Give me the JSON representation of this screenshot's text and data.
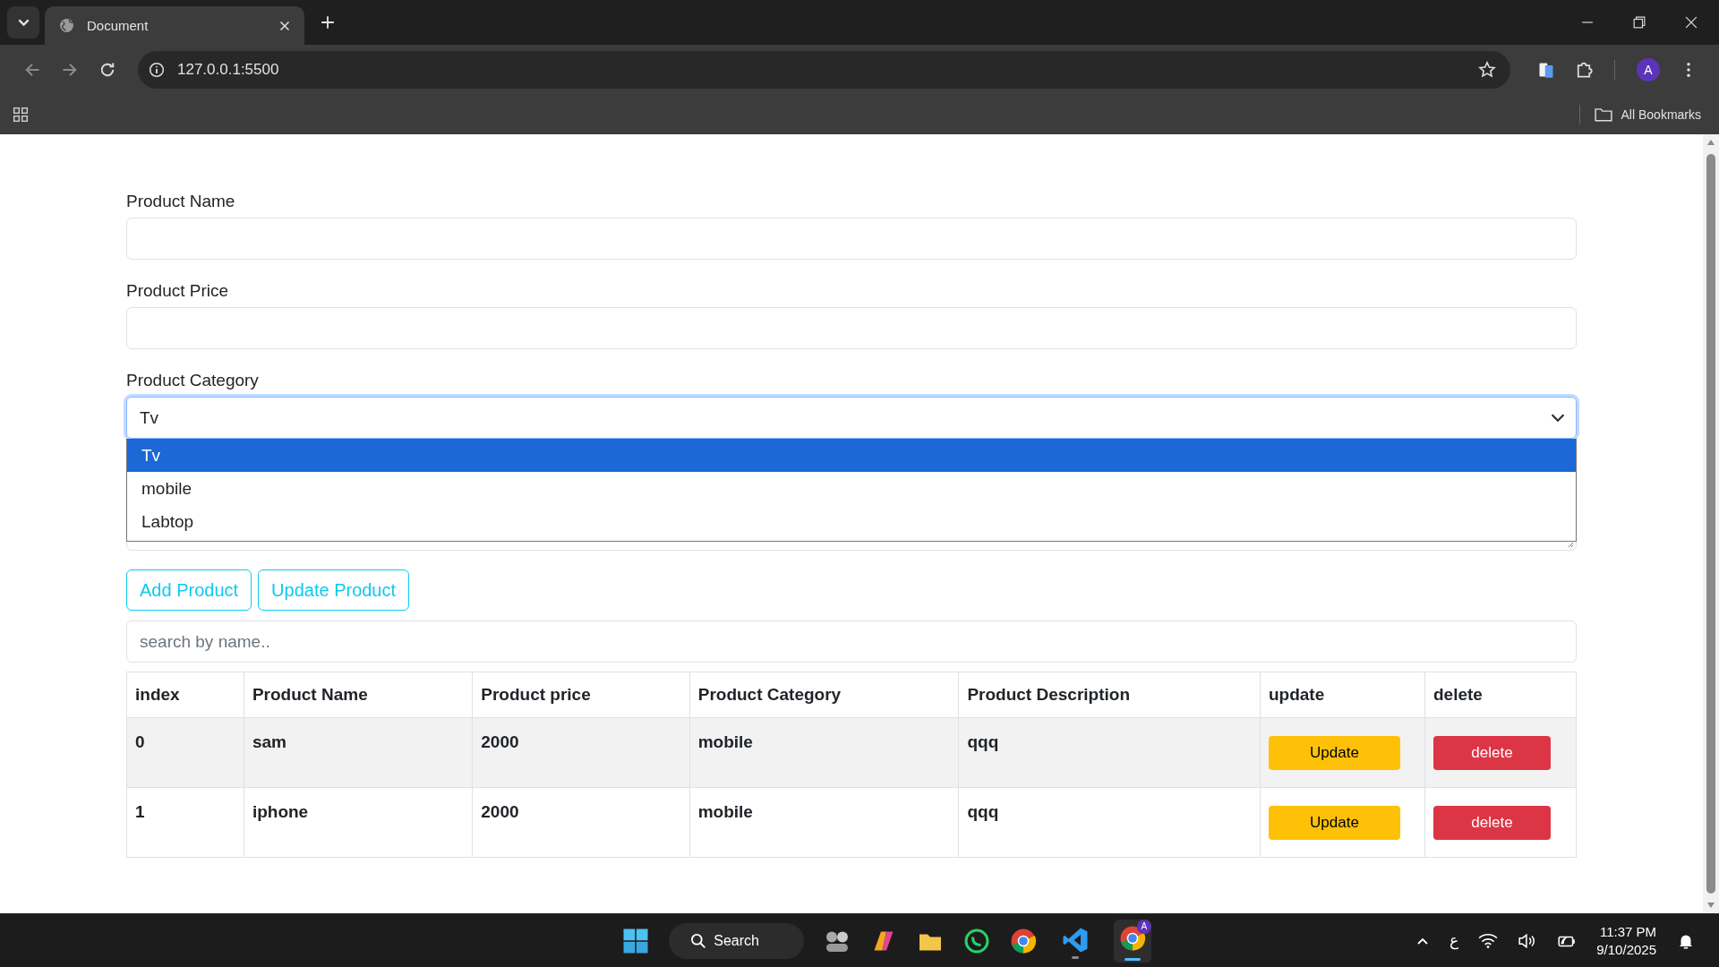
{
  "browser": {
    "tabs": [
      {
        "title": "Document",
        "selected": true
      }
    ],
    "address": "127.0.0.1:5500",
    "profile_initial": "A",
    "bookmarks": [
      "All Bookmarks"
    ]
  },
  "form": {
    "fields": [
      {
        "label": "Product Name"
      },
      {
        "label": "Product Price"
      }
    ],
    "category": {
      "label": "Product Category",
      "value": "Tv",
      "expanded": true,
      "options": [
        {
          "label": "Tv",
          "selected": true
        },
        {
          "label": "mobile",
          "selected": false
        },
        {
          "label": "Labtop",
          "selected": false
        }
      ]
    },
    "buttons": [
      "Add Product",
      "Update Product"
    ],
    "search": {
      "placeholder": "search by name.."
    }
  },
  "table": {
    "columns": [
      "index",
      "Product Name",
      "Product price",
      "Product Category",
      "Product Description",
      "update",
      "delete"
    ],
    "rows": [
      {
        "cells": [
          "0",
          "sam",
          "2000",
          "mobile",
          "qqq"
        ],
        "update": "Update",
        "delete": "delete"
      },
      {
        "cells": [
          "1",
          "iphone",
          "2000",
          "mobile",
          "qqq"
        ],
        "update": "Update",
        "delete": "delete"
      }
    ]
  },
  "taskbar": {
    "search": "Search",
    "badge": "A",
    "input_indicator": "ع",
    "time": "11:37 PM",
    "date": "9/10/2025"
  }
}
